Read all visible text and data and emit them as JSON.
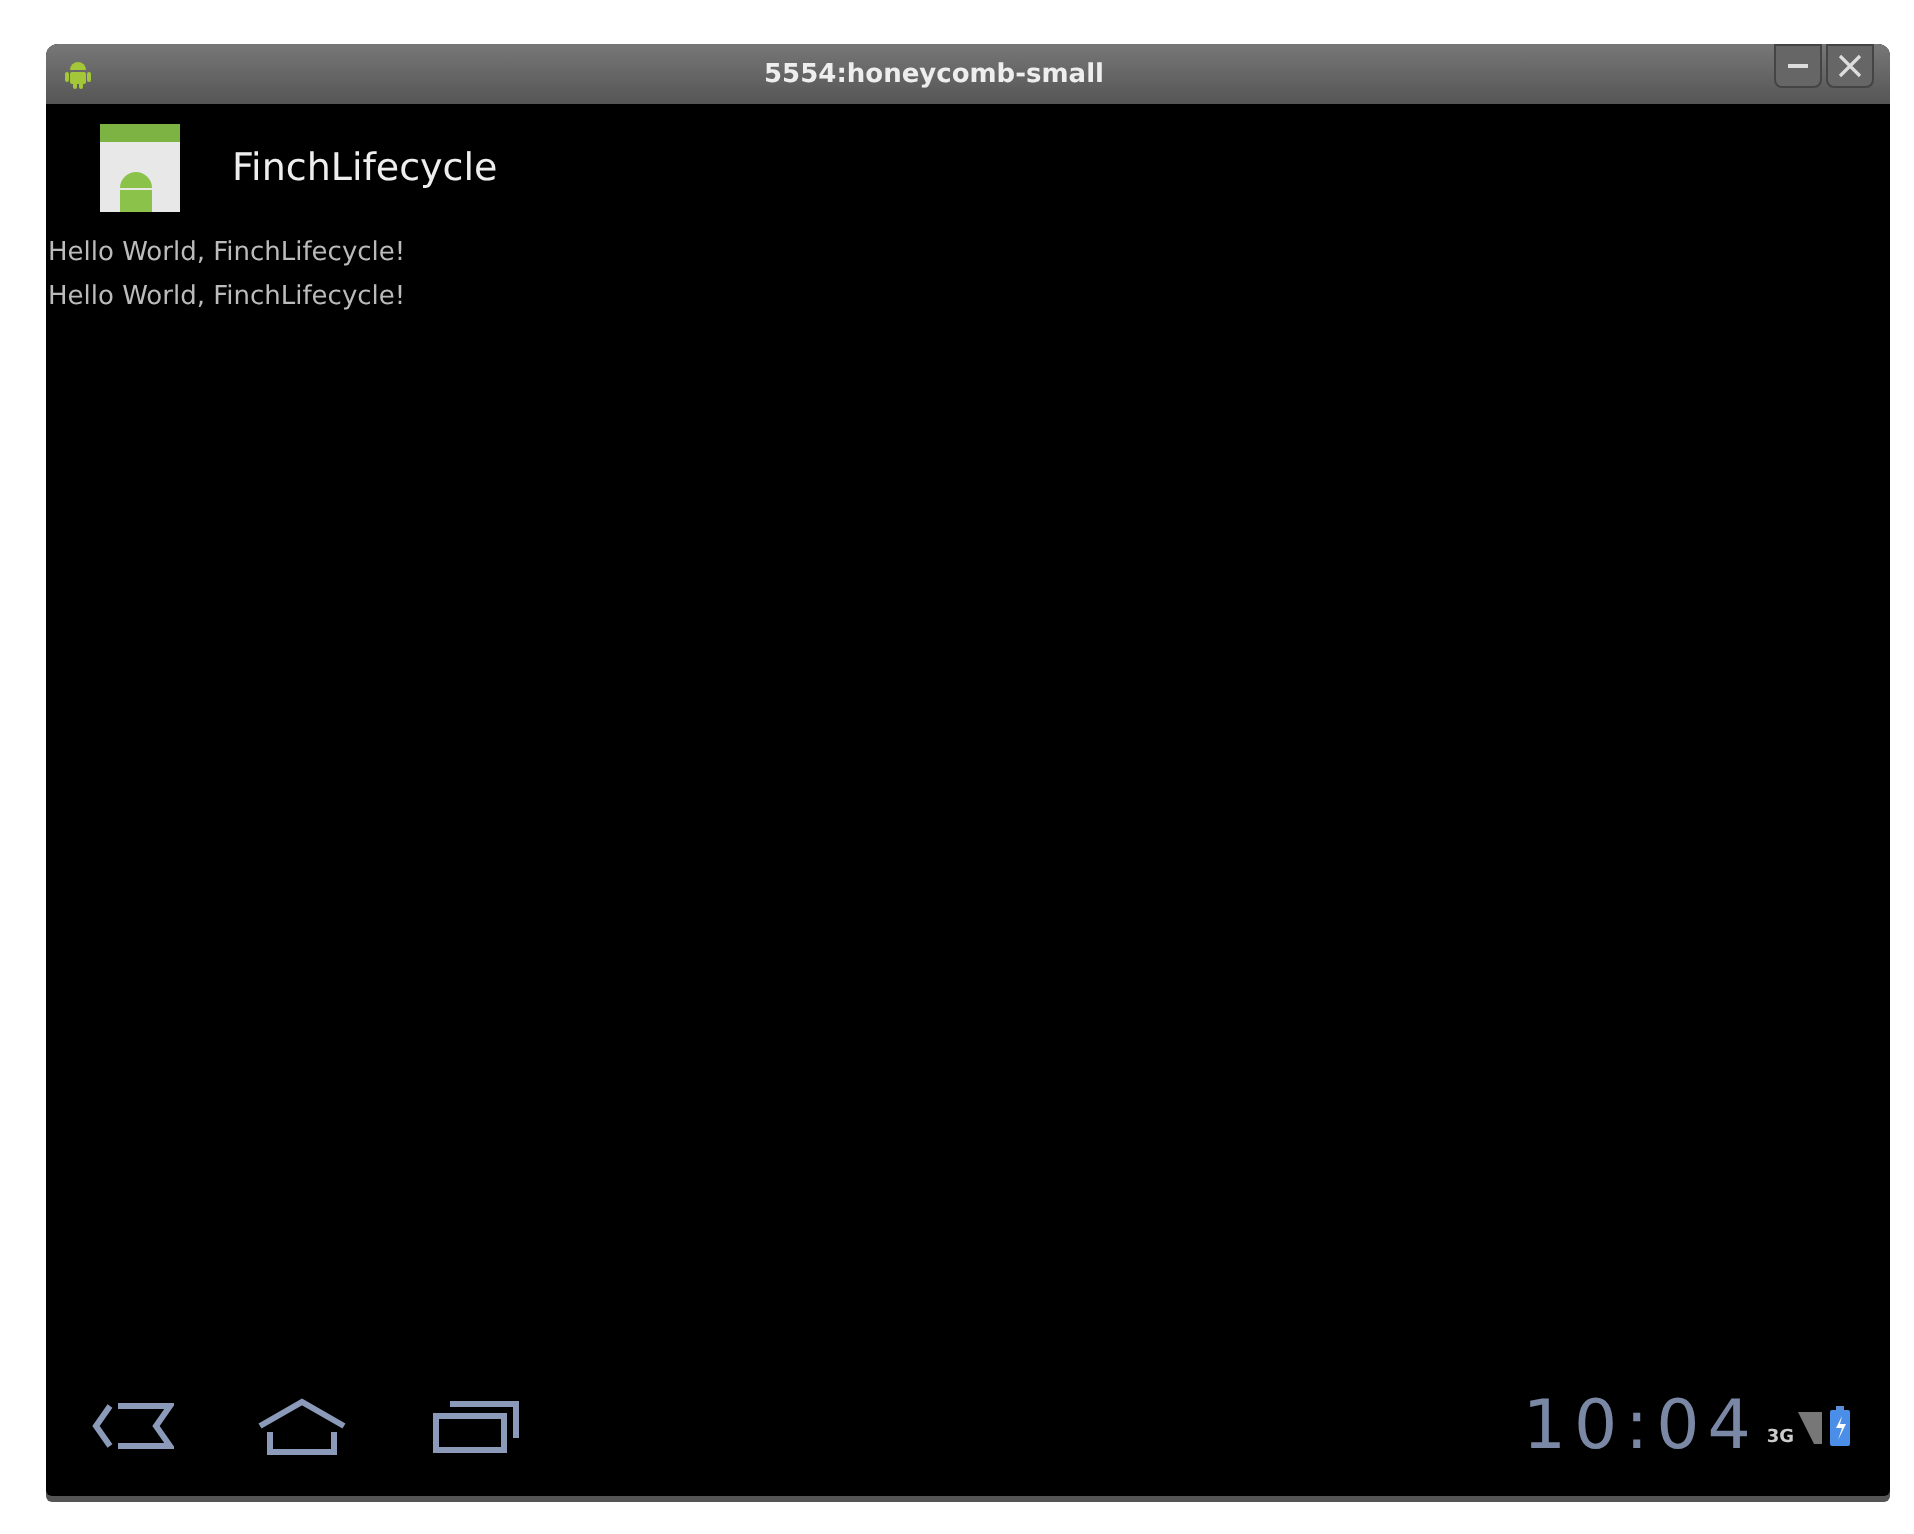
{
  "window": {
    "title": "5554:honeycomb-small"
  },
  "app_bar": {
    "title": "FinchLifecycle"
  },
  "content": {
    "lines": [
      "Hello World, FinchLifecycle!",
      "Hello World, FinchLifecycle!"
    ]
  },
  "status_bar": {
    "clock": "10:04",
    "network": "3G"
  }
}
